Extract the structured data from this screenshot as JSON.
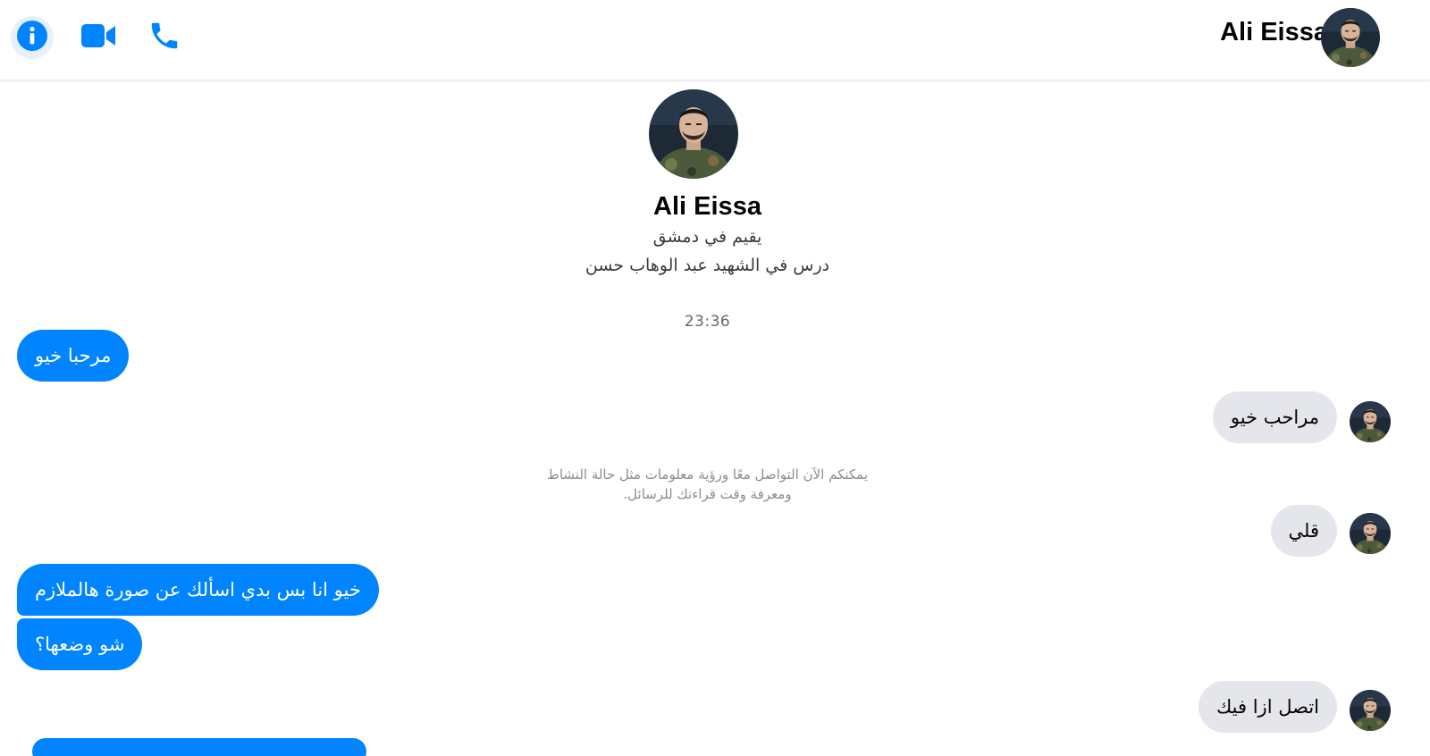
{
  "header": {
    "contact_name": "Ali Eissa",
    "actions": [
      {
        "name": "info-icon",
        "color": "#0084ff"
      },
      {
        "name": "video-camera-icon",
        "color": "#0084ff"
      },
      {
        "name": "phone-icon",
        "color": "#0084ff"
      }
    ]
  },
  "profile": {
    "name": "Ali Eissa",
    "lives_in": "يقيم في دمشق",
    "studied_at": "درس في الشهيد عبد الوهاب حسن"
  },
  "conversation": {
    "timestamp": "23:36",
    "notice_line1": "يمكنكم الآن التواصل معًا ورؤية معلومات مثل حالة النشاط",
    "notice_line2": "ومعرفة وقت قراءتك للرسائل.",
    "messages": [
      {
        "direction": "outgoing",
        "text": "مرحبا خيو"
      },
      {
        "direction": "incoming",
        "text": "مراحب  خيو"
      },
      {
        "direction": "incoming",
        "text": "قلي"
      },
      {
        "direction": "outgoing",
        "text": "خيو انا بس بدي اسألك عن صورة هالملازم"
      },
      {
        "direction": "outgoing",
        "text": "شو وضعها؟"
      },
      {
        "direction": "incoming",
        "text": "اتصل ازا فيك"
      }
    ]
  },
  "colors": {
    "accent": "#0084ff",
    "incoming_bubble": "#e4e6eb",
    "outgoing_bubble": "#0084ff"
  }
}
